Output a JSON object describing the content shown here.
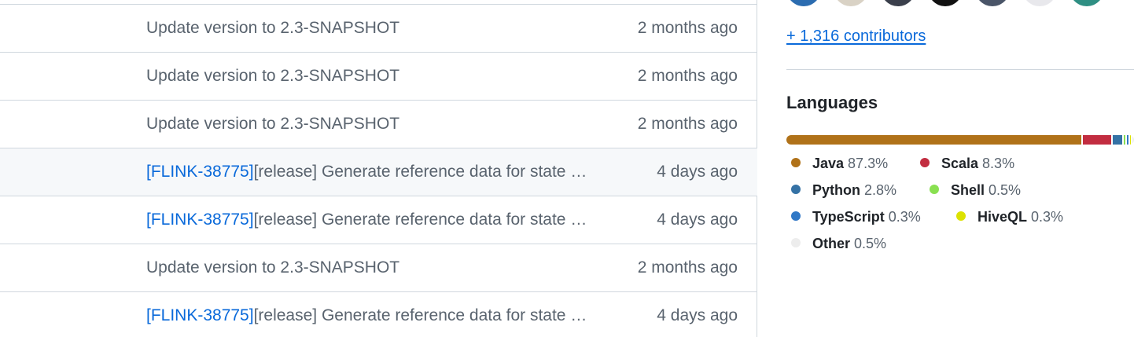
{
  "file_list": {
    "rows": [
      {
        "issue": "",
        "message": "Update version to 2.3-SNAPSHOT",
        "date": "2 months ago"
      },
      {
        "issue": "",
        "message": "Update version to 2.3-SNAPSHOT",
        "date": "2 months ago"
      },
      {
        "issue": "",
        "message": "Update version to 2.3-SNAPSHOT",
        "date": "2 months ago"
      },
      {
        "issue": "[FLINK-38775]",
        "message": "[release] Generate reference data for state migration tests",
        "date": "4 days ago"
      },
      {
        "issue": "[FLINK-38775]",
        "message": "[release] Generate reference data for state migration tests",
        "date": "4 days ago"
      },
      {
        "issue": "",
        "message": "Update version to 2.3-SNAPSHOT",
        "date": "2 months ago"
      },
      {
        "issue": "[FLINK-38775]",
        "message": "[release] Generate reference data for state migration tests",
        "date": "4 days ago"
      }
    ]
  },
  "sidebar": {
    "avatars": [
      {
        "color": "#2b6cb0"
      },
      {
        "color": "#d9d2c5"
      },
      {
        "color": "#3a3f4b"
      },
      {
        "color": "#111111"
      },
      {
        "color": "#4a5568"
      },
      {
        "color": "#e8e8ec"
      },
      {
        "color": "#2f8f83"
      }
    ],
    "contributors_link": "+ 1,316 contributors",
    "languages_heading": "Languages",
    "languages": [
      {
        "name": "Java",
        "percent": "87.3%",
        "value": 87.3,
        "color": "#b07219"
      },
      {
        "name": "Scala",
        "percent": "8.3%",
        "value": 8.3,
        "color": "#c22d40"
      },
      {
        "name": "Python",
        "percent": "2.8%",
        "value": 2.8,
        "color": "#3572a5"
      },
      {
        "name": "Shell",
        "percent": "0.5%",
        "value": 0.5,
        "color": "#89e051"
      },
      {
        "name": "TypeScript",
        "percent": "0.3%",
        "value": 0.3,
        "color": "#3178c6"
      },
      {
        "name": "HiveQL",
        "percent": "0.3%",
        "value": 0.3,
        "color": "#dce200"
      },
      {
        "name": "Other",
        "percent": "0.5%",
        "value": 0.5,
        "color": "#ededed"
      }
    ]
  }
}
